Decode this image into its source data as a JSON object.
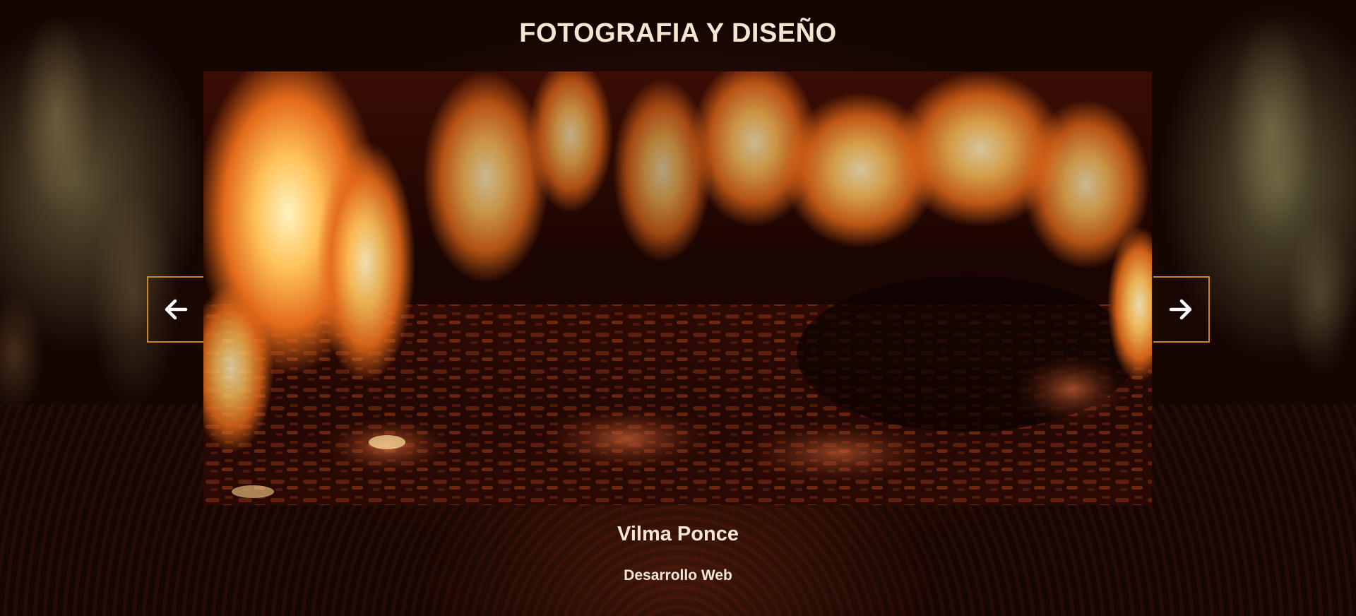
{
  "header": {
    "title": "FOTOGRAFIA Y DISEÑO"
  },
  "slider": {
    "image": "fire-flames-embers",
    "prev_icon": "arrow-left-icon",
    "next_icon": "arrow-right-icon",
    "arrow_border_color": "#c8871f"
  },
  "caption": {
    "name": "Vilma Ponce",
    "role": "Desarrollo Web"
  },
  "colors": {
    "text": "#f3e7d3",
    "accent": "#c8871f"
  }
}
